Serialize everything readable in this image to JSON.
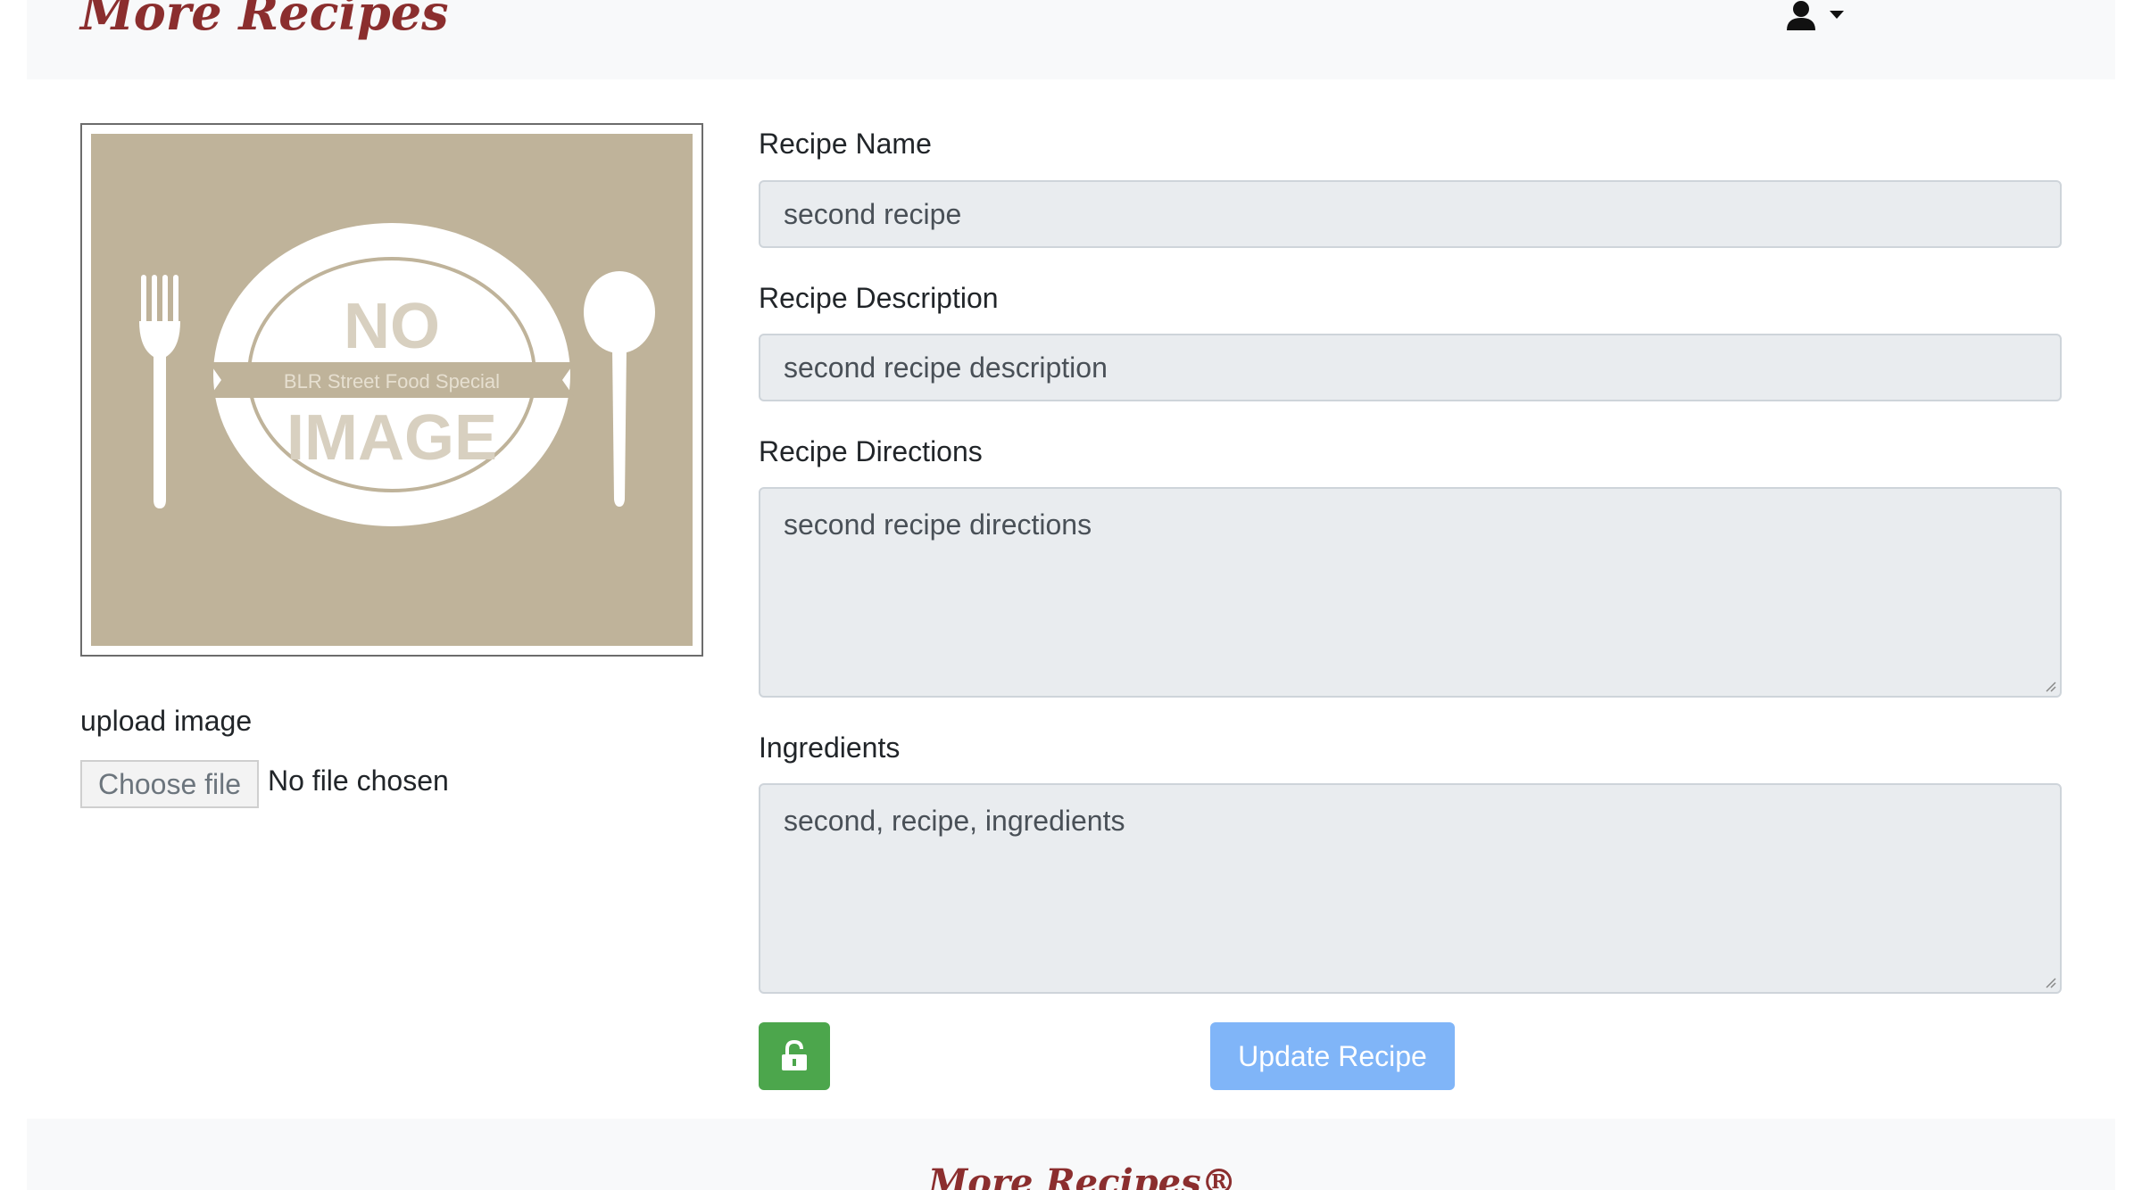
{
  "header": {
    "brand": "More Recipes",
    "user_icon": "user-icon",
    "dropdown_icon": "caret-down-icon"
  },
  "image_panel": {
    "placeholder_icon": "no-image-placeholder",
    "placeholder_text_top": "NO",
    "placeholder_banner": "BLR Street Food Special",
    "placeholder_text_bottom": "IMAGE",
    "upload_label": "upload image",
    "choose_file_button": "Choose file",
    "file_status": "No file chosen"
  },
  "form": {
    "recipe_name_label": "Recipe Name",
    "recipe_name_value": "second recipe",
    "recipe_description_label": "Recipe Description",
    "recipe_description_value": "second recipe description",
    "recipe_directions_label": "Recipe Directions",
    "recipe_directions_value": "second recipe directions",
    "ingredients_label": "Ingredients",
    "ingredients_value": "second, recipe, ingredients",
    "lock_icon": "unlock-icon",
    "update_button": "Update Recipe"
  },
  "footer": {
    "brand": "More Recipes®"
  },
  "colors": {
    "brand": "#8b2e2e",
    "navbar_bg": "#f8f9fa",
    "field_bg": "#e9ecef",
    "lock_button": "#4ca64c",
    "update_button": "#80b5f8",
    "placeholder_bg": "#bfb39a"
  }
}
